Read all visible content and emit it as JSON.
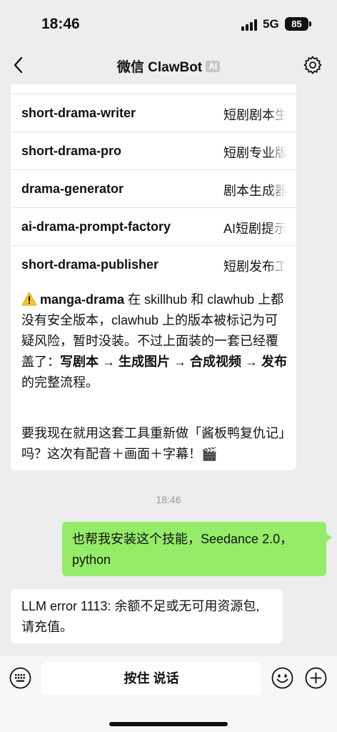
{
  "status_bar": {
    "time": "18:46",
    "network": "5G",
    "battery": "85"
  },
  "nav": {
    "title": "微信 ClawBot",
    "badge": "AI",
    "back_icon": "chevron-left-icon",
    "settings_icon": "gear-icon"
  },
  "bot_message": {
    "skills": [
      {
        "name": "short-drama-writer",
        "desc": "短剧剧本生成"
      },
      {
        "name": "short-drama-pro",
        "desc": "短剧专业版"
      },
      {
        "name": "drama-generator",
        "desc": "剧本生成器"
      },
      {
        "name": "ai-drama-prompt-factory",
        "desc": "AI短剧提示词"
      },
      {
        "name": "short-drama-publisher",
        "desc": "短剧发布工具"
      }
    ],
    "warning": {
      "icon": "warning-icon",
      "skill": "manga-drama",
      "text1": " 在 skillhub 和 clawhub 上都没有安全版本，clawhub 上的版本被标记为可疑风险，暂时没装。不过上面装的一套已经覆盖了：",
      "flow": "写剧本 → 生成图片 → 合成视频 → 发布",
      "text2": " 的完整流程。"
    },
    "ask": "要我现在就用这套工具重新做「酱板鸭复仇记」吗？这次有配音＋画面＋字幕！🎬"
  },
  "timestamp": "18:46",
  "user_message": "也帮我安装这个技能，Seedance 2.0，python",
  "bot_reply": "LLM error 1113: 余额不足或无可用资源包,请充值。",
  "input_bar": {
    "hold_to_talk": "按住 说话",
    "keyboard_icon": "keyboard-icon",
    "emoji_icon": "emoji-icon",
    "plus_icon": "plus-icon"
  },
  "colors": {
    "background": "#ededed",
    "outgoing_bubble": "#95ec69",
    "incoming_bubble": "#ffffff"
  }
}
